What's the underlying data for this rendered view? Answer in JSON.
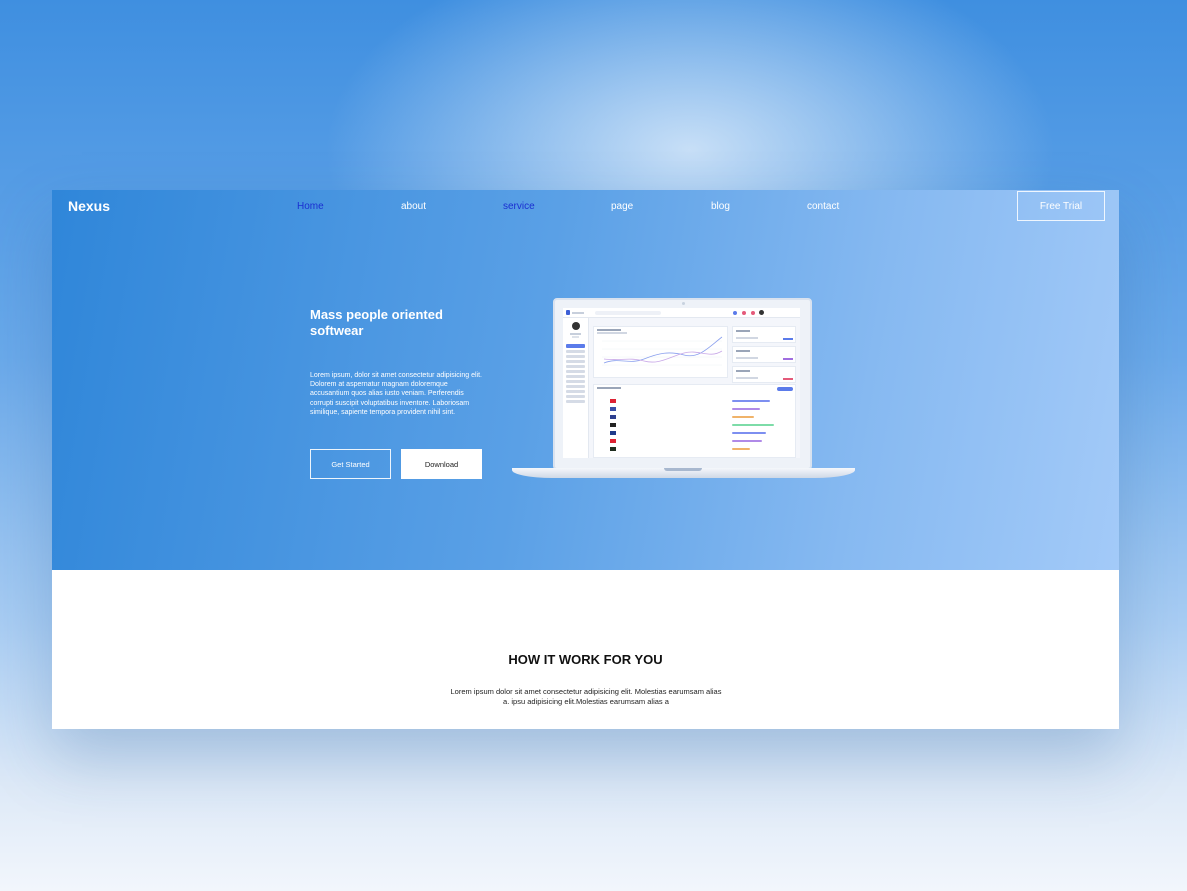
{
  "nav": {
    "logo": "Nexus",
    "links": [
      {
        "label": "Home"
      },
      {
        "label": "about"
      },
      {
        "label": "service"
      },
      {
        "label": "page"
      },
      {
        "label": "blog"
      },
      {
        "label": "contact"
      }
    ],
    "cta_label": "Free Trial",
    "active_link_color": "#1a2fd1"
  },
  "hero": {
    "title": "Mass people oriented softwear",
    "description": "Lorem ipsum, dolor sit amet consectetur adipisicing elit. Dolorem at aspernatur magnam doloremque accusantium quos alias iusto veniam. Perferendis corrupti suscipit voluptatibus inventore. Laboriosam similique, sapiente tempora provident nihil sint.",
    "primary_button": "Get Started",
    "secondary_button": "Download",
    "gradient_start": "#2f86d9",
    "gradient_end": "#a3caf8"
  },
  "section": {
    "title": "HOW IT WORK FOR YOU",
    "text": "Lorem ipsum dolor sit amet consectetur adipisicing elit. Molestias earumsam alias a. ipsu adipisicing elit.Molestias earumsam alias a"
  }
}
